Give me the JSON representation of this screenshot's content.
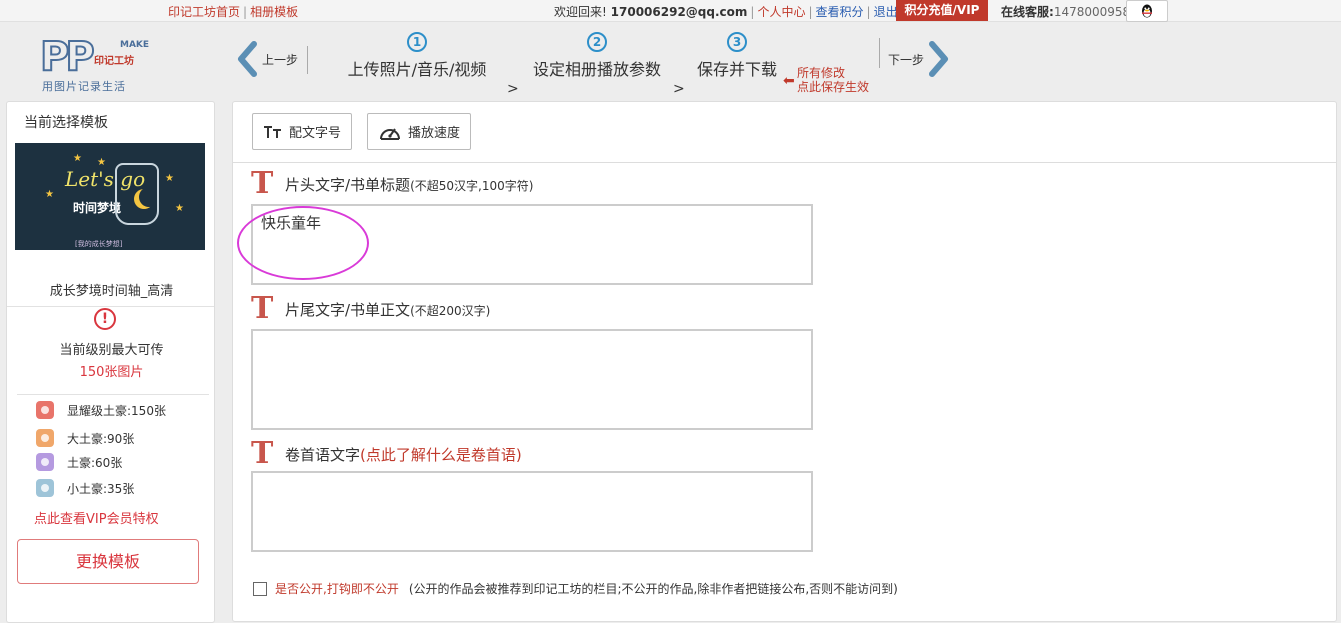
{
  "topbar": {
    "home_link": "印记工坊首页",
    "template_link": "相册模板",
    "welcome": "欢迎回来!",
    "email": "170006292@qq.com",
    "personal_center": "个人中心",
    "view_points": "查看积分",
    "logout": "退出",
    "vip_button": "积分充值/VIP",
    "service_label": "在线客服:",
    "service_number": "1478000958"
  },
  "header": {
    "logo_pp": "PP",
    "logo_make": "MAKE",
    "logo_brand": "印记工坊",
    "logo_slogan": "用图片记录生活",
    "prev_label": "上一步",
    "next_label": "下一步",
    "steps": [
      {
        "num": "1",
        "title": "上传照片/音乐/视频"
      },
      {
        "num": "2",
        "title": "设定相册播放参数"
      },
      {
        "num": "3",
        "title": "保存并下载"
      }
    ],
    "save_note_line1": "所有修改",
    "save_note_line2": "点此保存生效"
  },
  "sidebar": {
    "title": "当前选择模板",
    "thumb_lets": "Let's go",
    "thumb_title": "时间梦境",
    "thumb_footer": "[我的成长梦想]",
    "template_name": "成长梦境时间轴_高清",
    "level_text": "当前级别最大可传",
    "level_num": "150张图片",
    "tiers": [
      {
        "label": "显耀级土豪:150张",
        "color": "#e8746a"
      },
      {
        "label": "大土豪:90张",
        "color": "#f0a76a"
      },
      {
        "label": "土豪:60张",
        "color": "#b59ae0"
      },
      {
        "label": "小土豪:35张",
        "color": "#9ec4d8"
      }
    ],
    "vip_link": "点此查看VIP会员特权",
    "change_button": "更换模板"
  },
  "main": {
    "tool_font": "配文字号",
    "tool_speed": "播放速度",
    "field1_label": "片头文字/书单标题",
    "field1_hint": "(不超50汉字,100字符)",
    "field1_value": "快乐童年",
    "field2_label": "片尾文字/书单正文",
    "field2_hint": "(不超200汉字)",
    "field2_value": "",
    "field3_label": "卷首语文字",
    "field3_link": "(点此了解什么是卷首语)",
    "field3_value": "",
    "public_label": "是否公开,打钩即不公开",
    "public_note": "(公开的作品会被推荐到印记工坊的栏目;不公开的作品,除非作者把链接公布,否则不能访问到)"
  }
}
